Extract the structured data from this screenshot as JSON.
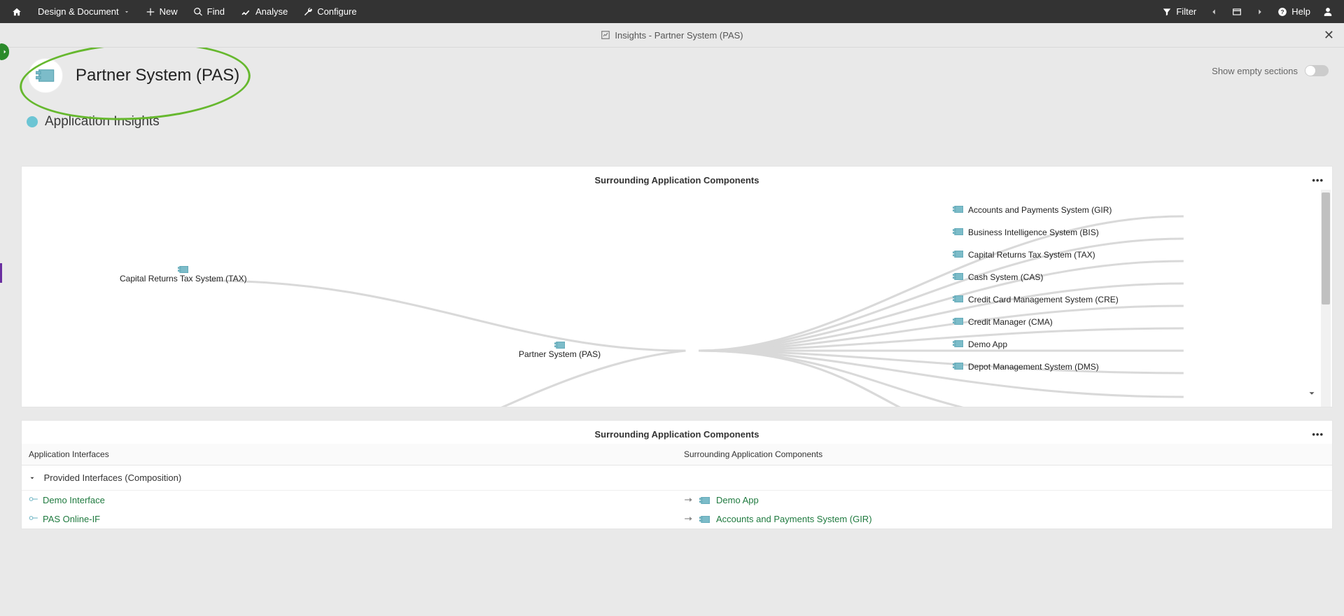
{
  "toolbar": {
    "menu_label": "Design & Document",
    "new_label": "New",
    "find_label": "Find",
    "analyse_label": "Analyse",
    "configure_label": "Configure",
    "filter_label": "Filter",
    "help_label": "Help"
  },
  "tab": {
    "title": "Insights - Partner System (PAS)"
  },
  "page": {
    "title": "Partner System (PAS)",
    "section_heading": "Application Insights",
    "show_empty_label": "Show empty sections"
  },
  "panel1": {
    "title": "Surrounding Application Components"
  },
  "diagram": {
    "left_node": "Capital Returns Tax System (TAX)",
    "center_node": "Partner System (PAS)",
    "right_nodes": [
      "Accounts and Payments System (GIR)",
      "Business Intelligence System (BIS)",
      "Capital Returns Tax System (TAX)",
      "Cash System (CAS)",
      "Credit Card Management System (CRE)",
      "Credit Manager (CMA)",
      "Demo App",
      "Depot Management System (DMS)"
    ]
  },
  "panel2": {
    "title": "Surrounding Application Components",
    "col1": "Application Interfaces",
    "col2": "Surrounding Application Components",
    "group_label": "Provided Interfaces (Composition)",
    "rows": [
      {
        "iface": "Demo Interface",
        "target": "Demo App"
      },
      {
        "iface": "PAS Online-IF",
        "target": "Accounts and Payments System (GIR)"
      }
    ]
  }
}
